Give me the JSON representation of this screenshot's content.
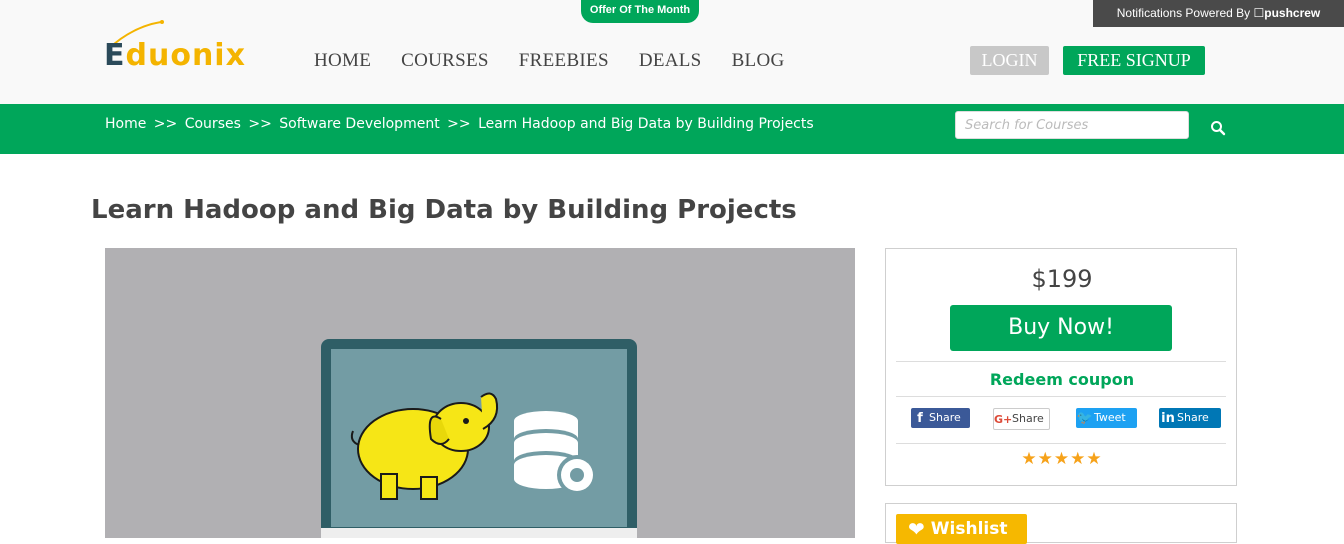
{
  "pushcrew": {
    "prefix": "Notifications Powered By",
    "brand": "pushcrew"
  },
  "offer": {
    "label": "Offer Of The Month"
  },
  "logo": {
    "first": "E",
    "rest": "duonix"
  },
  "nav": {
    "items": [
      "HOME",
      "COURSES",
      "FREEBIES",
      "DEALS",
      "BLOG"
    ]
  },
  "auth": {
    "login": "LOGIN",
    "signup": "FREE SIGNUP"
  },
  "breadcrumb": {
    "items": [
      "Home",
      "Courses",
      "Software Development",
      "Learn Hadoop and Big Data by Building Projects"
    ],
    "separator": ">>"
  },
  "search": {
    "placeholder": "Search for Courses"
  },
  "page": {
    "title": "Learn Hadoop and Big Data by Building Projects"
  },
  "purchase": {
    "price": "$199",
    "buy_label": "Buy Now!",
    "coupon_label": "Redeem coupon",
    "rating_stars": 5
  },
  "share": {
    "facebook": "Share",
    "google": "Share",
    "twitter": "Tweet",
    "linkedin": "Share"
  },
  "wishlist": {
    "label": "Wishlist"
  },
  "colors": {
    "brand_green": "#00a65a",
    "star": "#f6a21a",
    "wishlist": "#f6b800",
    "facebook": "#3b5998",
    "twitter": "#1da1f2",
    "linkedin": "#0077b5"
  },
  "icons": {
    "search": "search-icon",
    "heart": "heart-icon",
    "elephant": "hadoop-elephant-icon",
    "database": "database-gear-icon"
  }
}
